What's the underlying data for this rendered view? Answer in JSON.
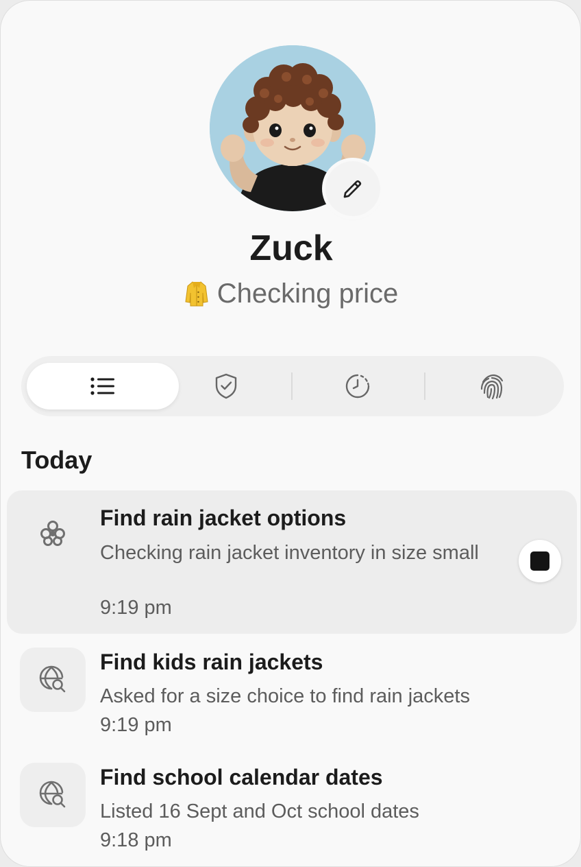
{
  "profile": {
    "name": "Zuck",
    "status_text": "Checking price",
    "status_emoji_icon": "coat-icon",
    "avatar_background": "#a9d1e2"
  },
  "tabs": [
    {
      "icon": "list-icon",
      "active": true
    },
    {
      "icon": "shield-check-icon",
      "active": false
    },
    {
      "icon": "clock-icon",
      "active": false
    },
    {
      "icon": "fingerprint-icon",
      "active": false
    }
  ],
  "section": {
    "title": "Today"
  },
  "tasks": [
    {
      "icon": "agent-icon",
      "title": "Find rain jacket options",
      "description": "Checking rain jacket inventory in size small",
      "time": "9:19 pm",
      "in_progress": true
    },
    {
      "icon": "globe-search-icon",
      "title": "Find kids rain jackets",
      "description": "Asked for a size choice to find rain jackets",
      "time": "9:19 pm",
      "in_progress": false
    },
    {
      "icon": "globe-search-icon",
      "title": "Find school calendar dates",
      "description": "Listed 16 Sept and Oct school dates",
      "time": "9:18 pm",
      "in_progress": false
    }
  ],
  "colors": {
    "background": "#f9f9f9",
    "active_row": "#ededed",
    "text_primary": "#1c1c1c",
    "text_secondary": "#5c5c5c"
  }
}
